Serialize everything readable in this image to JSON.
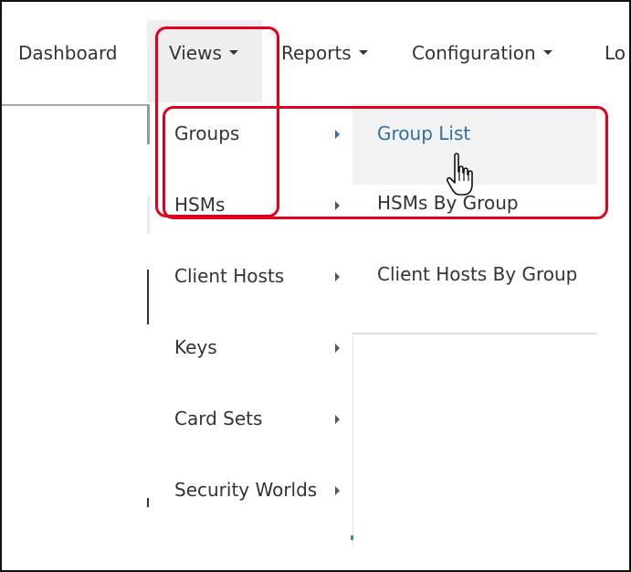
{
  "navbar": {
    "items": [
      {
        "label": "Dashboard",
        "dropdown": false
      },
      {
        "label": "Views",
        "dropdown": true,
        "active": true
      },
      {
        "label": "Reports",
        "dropdown": true
      },
      {
        "label": "Configuration",
        "dropdown": true
      },
      {
        "label": "Lo",
        "dropdown": false
      }
    ]
  },
  "views_menu": {
    "items": [
      {
        "label": "Groups",
        "active": true
      },
      {
        "label": "HSMs"
      },
      {
        "label": "Client Hosts"
      },
      {
        "label": "Keys"
      },
      {
        "label": "Card Sets"
      },
      {
        "label": "Security Worlds"
      }
    ]
  },
  "groups_submenu": {
    "items": [
      {
        "label": "Group List",
        "hovered": true
      },
      {
        "label": "HSMs By Group"
      },
      {
        "label": "Client Hosts By Group"
      }
    ]
  },
  "colors": {
    "annotation": "#e0001b",
    "link_active": "#2f6fa8",
    "text": "#333333"
  },
  "icons": {
    "cursor": "hand-pointer-icon"
  }
}
